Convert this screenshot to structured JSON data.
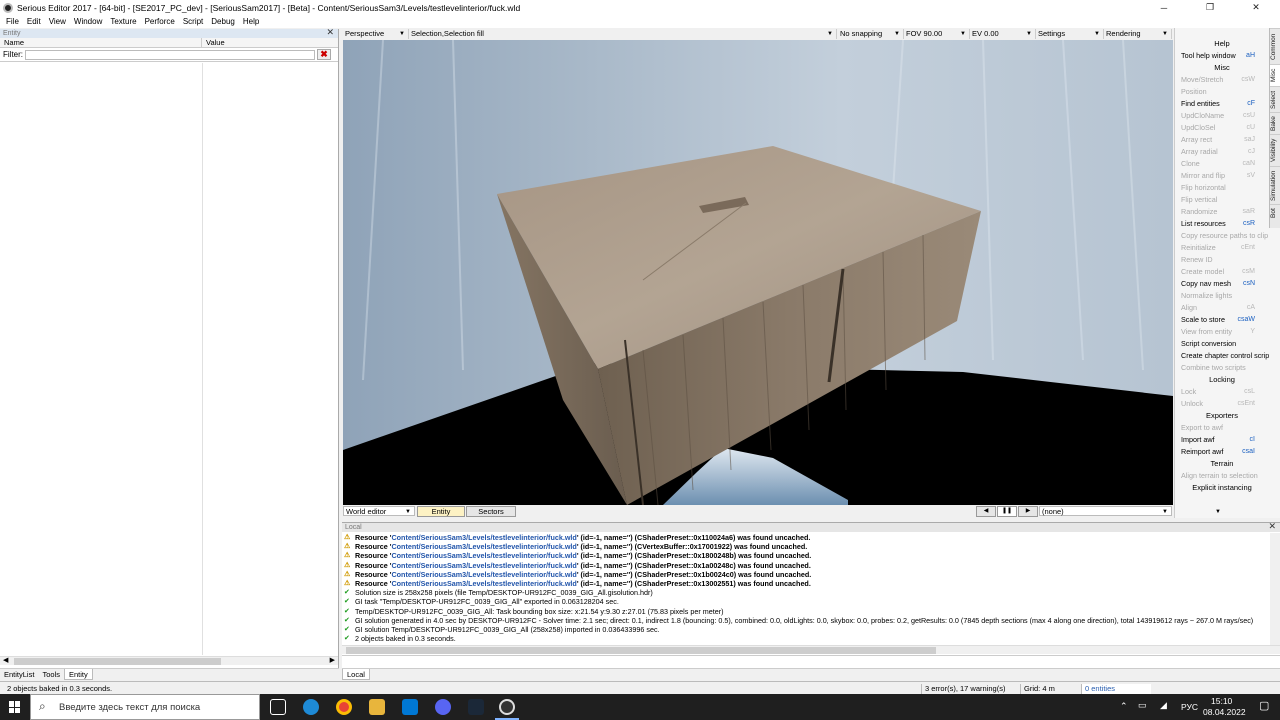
{
  "window": {
    "title": "Serious Editor 2017 - [64-bit] - [SE2017_PC_dev] - [SeriousSam2017] - [Beta] - Content/SeriousSam3/Levels/testlevelinterior/fuck.wld",
    "controls": [
      "─",
      "❐",
      "✕"
    ]
  },
  "menu": [
    "File",
    "Edit",
    "View",
    "Window",
    "Texture",
    "Perforce",
    "Script",
    "Debug",
    "Help"
  ],
  "entity_panel": {
    "header": "Entity",
    "col_name": "Name",
    "col_value": "Value",
    "filter_label": "Filter:",
    "filter_value": "",
    "clear_icon": "✖",
    "tabs": [
      "EntityList",
      "Tools",
      "Entity"
    ],
    "active_tab": "Entity"
  },
  "viewport_toolbar": {
    "view": "Perspective",
    "selection": "Selection,Selection fill",
    "snapping": "No snapping",
    "fov": "FOV 90.00",
    "ev": "EV  0.00",
    "settings": "Settings",
    "rendering": "Rendering"
  },
  "viewport_bottom": {
    "mode": "World editor",
    "tab_entity": "Entity",
    "tab_sectors": "Sectors",
    "playback": [
      "◀",
      "❚❚",
      "▶"
    ],
    "none_value": "(none)"
  },
  "right_panel": {
    "sections": [
      {
        "title": "Help",
        "items": [
          {
            "label": "Tool help window",
            "shortcut": "aH",
            "enabled": true
          }
        ]
      },
      {
        "title": "Misc",
        "items": [
          {
            "label": "Move/Stretch",
            "shortcut": "csW",
            "enabled": false
          },
          {
            "label": "Position",
            "shortcut": "",
            "enabled": false
          },
          {
            "label": "Find entities",
            "shortcut": "cF",
            "enabled": true
          },
          {
            "label": "UpdCloName",
            "shortcut": "csU",
            "enabled": false
          },
          {
            "label": "UpdCloSel",
            "shortcut": "cU",
            "enabled": false
          },
          {
            "label": "Array rect",
            "shortcut": "saJ",
            "enabled": false
          },
          {
            "label": "Array radial",
            "shortcut": "cJ",
            "enabled": false
          },
          {
            "label": "Clone",
            "shortcut": "caN",
            "enabled": false
          },
          {
            "label": "Mirror and flip",
            "shortcut": "sV",
            "enabled": false
          },
          {
            "label": "Flip horizontal",
            "shortcut": "",
            "enabled": false
          },
          {
            "label": "Flip vertical",
            "shortcut": "",
            "enabled": false
          },
          {
            "label": "Randomize",
            "shortcut": "saR",
            "enabled": false
          },
          {
            "label": "List resources",
            "shortcut": "csR",
            "enabled": true
          },
          {
            "label": "Copy resource paths to clip",
            "shortcut": "",
            "enabled": false
          },
          {
            "label": "Reinitialize",
            "shortcut": "cEnt",
            "enabled": false
          },
          {
            "label": "Renew ID",
            "shortcut": "",
            "enabled": false
          },
          {
            "label": "Create model",
            "shortcut": "csM",
            "enabled": false
          },
          {
            "label": "Copy nav mesh",
            "shortcut": "csN",
            "enabled": true
          },
          {
            "label": "Normalize lights",
            "shortcut": "",
            "enabled": false
          },
          {
            "label": "Align",
            "shortcut": "cA",
            "enabled": false
          },
          {
            "label": "Scale to store",
            "shortcut": "csaW",
            "enabled": true
          },
          {
            "label": "View from entity",
            "shortcut": "Y",
            "enabled": false
          },
          {
            "label": "Script conversion",
            "shortcut": "",
            "enabled": true
          },
          {
            "label": "Create chapter control script",
            "shortcut": "",
            "enabled": true
          },
          {
            "label": "Combine two scripts",
            "shortcut": "",
            "enabled": false
          }
        ]
      },
      {
        "title": "Locking",
        "items": [
          {
            "label": "Lock",
            "shortcut": "csL",
            "enabled": false
          },
          {
            "label": "Unlock",
            "shortcut": "csEnt",
            "enabled": false
          }
        ]
      },
      {
        "title": "Exporters",
        "items": [
          {
            "label": "Export to awf",
            "shortcut": "",
            "enabled": false
          },
          {
            "label": "Import awf",
            "shortcut": "cI",
            "enabled": true
          },
          {
            "label": "Reimport awf",
            "shortcut": "csaI",
            "enabled": true
          }
        ]
      },
      {
        "title": "Terrain",
        "items": [
          {
            "label": "Align terrain to selection",
            "shortcut": "",
            "enabled": false
          }
        ]
      },
      {
        "title": "Explicit instancing",
        "items": []
      }
    ],
    "vertical_tabs": [
      "Common",
      "Misc",
      "Select",
      "Bake",
      "Visibility",
      "Simulation",
      "Bot"
    ],
    "active_vtab": "Misc"
  },
  "log": {
    "header": "Local",
    "lines": [
      {
        "type": "warn",
        "pre": "Resource '",
        "file": "Content/SeriousSam3/Levels/testlevelinterior/fuck.wld",
        "post": "' (id=-1, name='') (CShaderPreset::0x110024a6) was found uncached."
      },
      {
        "type": "warn",
        "pre": "Resource '",
        "file": "Content/SeriousSam3/Levels/testlevelinterior/fuck.wld",
        "post": "' (id=-1, name='') (CVertexBuffer::0x17001922) was found uncached."
      },
      {
        "type": "warn",
        "pre": "Resource '",
        "file": "Content/SeriousSam3/Levels/testlevelinterior/fuck.wld",
        "post": "' (id=-1, name='') (CShaderPreset::0x1800248b) was found uncached."
      },
      {
        "type": "warn",
        "pre": "Resource '",
        "file": "Content/SeriousSam3/Levels/testlevelinterior/fuck.wld",
        "post": "' (id=-1, name='') (CShaderPreset::0x1a00248c) was found uncached."
      },
      {
        "type": "warn",
        "pre": "Resource '",
        "file": "Content/SeriousSam3/Levels/testlevelinterior/fuck.wld",
        "post": "' (id=-1, name='') (CShaderPreset::0x1b0024c0) was found uncached."
      },
      {
        "type": "warn",
        "pre": "Resource '",
        "file": "Content/SeriousSam3/Levels/testlevelinterior/fuck.wld",
        "post": "' (id=-1, name='') (CShaderPreset::0x13002551) was found uncached."
      },
      {
        "type": "ok",
        "pre": "Solution size is 258x258 pixels (file Temp/DESKTOP-UR912FC_0039_GIG_All.gisolution.hdr)",
        "file": "",
        "post": ""
      },
      {
        "type": "ok",
        "pre": "GI task \"Temp/DESKTOP-UR912FC_0039_GIG_All\" exported in 0.063128204 sec.",
        "file": "",
        "post": ""
      },
      {
        "type": "ok",
        "pre": "Temp/DESKTOP-UR912FC_0039_GIG_All: Task bounding box size: x:21.54 y:9.30 z:27.01  (75.83 pixels per meter)",
        "file": "",
        "post": ""
      },
      {
        "type": "ok",
        "pre": "GI solution generated in 4.0 sec by DESKTOP-UR912FC - Solver time: 2.1 sec; direct: 0.1, indirect 1.8 (bouncing: 0.5), combined: 0.0, oldLights: 0.0, skybox: 0.0, probes: 0.2, getResults: 0.0 (7845 depth sections (max 4 along one direction), total 143919612 rays ~ 267.0 M rays/sec)",
        "file": "",
        "post": ""
      },
      {
        "type": "ok",
        "pre": "GI solution Temp/DESKTOP-UR912FC_0039_GIG_All (258x258) imported in 0.036433996 sec.",
        "file": "",
        "post": ""
      },
      {
        "type": "ok",
        "pre": "2 objects baked in 0.3 seconds.",
        "file": "",
        "post": ""
      }
    ],
    "tab": "Local"
  },
  "status": {
    "message": "2 objects baked in 0.3 seconds.",
    "errors": "3 error(s), 17 warning(s)",
    "grid": "Grid: 4 m",
    "entities": "0 entities"
  },
  "taskbar": {
    "search_placeholder": "Введите здесь текст для поиска",
    "lang": "РУС",
    "time": "15:10",
    "date": "08.04.2022"
  }
}
